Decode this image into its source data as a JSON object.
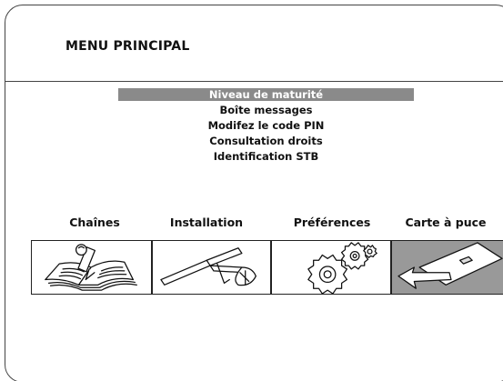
{
  "header": {
    "title": "MENU PRINCIPAL"
  },
  "menu": {
    "items": [
      {
        "label": "Niveau de maturité",
        "selected": true
      },
      {
        "label": "Boîte messages",
        "selected": false
      },
      {
        "label": "Modifez le code PIN",
        "selected": false
      },
      {
        "label": "Consultation droits",
        "selected": false
      },
      {
        "label": "Identification STB",
        "selected": false
      }
    ]
  },
  "categories": [
    {
      "label": "Chaînes",
      "icon": "book-pencil-icon",
      "selected": false
    },
    {
      "label": "Installation",
      "icon": "satellite-dish-icon",
      "selected": false
    },
    {
      "label": "Préférences",
      "icon": "gears-icon",
      "selected": false
    },
    {
      "label": "Carte à puce",
      "icon": "smart-card-icon",
      "selected": true
    }
  ],
  "colors": {
    "selection": "#8a8a8a",
    "selected_tile": "#999999",
    "outline": "#222222"
  }
}
